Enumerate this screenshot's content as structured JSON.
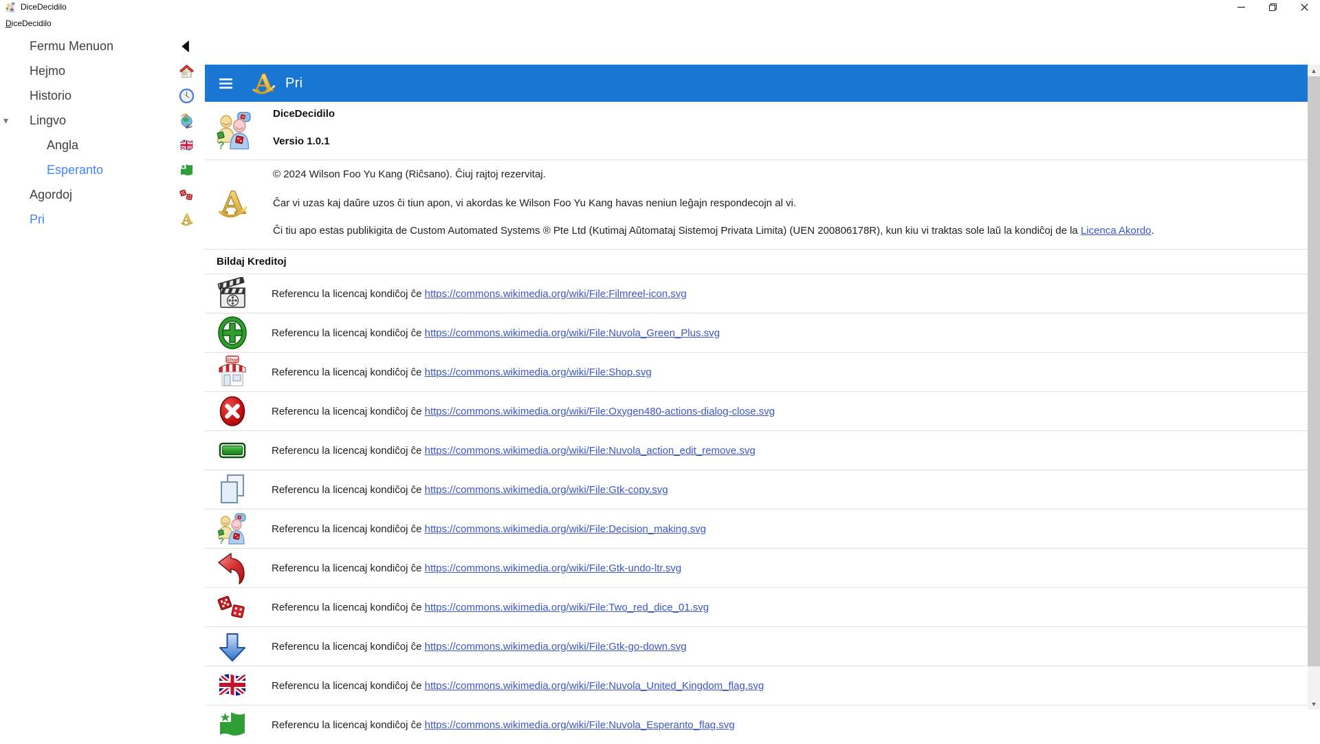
{
  "window": {
    "title": "DiceDecidilo",
    "menu_label": "DiceDecidilo"
  },
  "header": {
    "title": "Pri"
  },
  "sidebar": {
    "items": [
      {
        "label": "Fermu Menuon",
        "icon": "collapse-arrow-icon"
      },
      {
        "label": "Hejmo",
        "icon": "home-icon"
      },
      {
        "label": "Historio",
        "icon": "history-clock-icon"
      },
      {
        "label": "Lingvo",
        "icon": "language-globe-icon",
        "expander": true
      },
      {
        "label": "Angla",
        "icon": "uk-flag-icon",
        "indent": true
      },
      {
        "label": "Esperanto",
        "icon": "esperanto-flag-icon",
        "indent": true,
        "selected": true
      },
      {
        "label": "Agordoj",
        "icon": "red-dice-icon"
      },
      {
        "label": "Pri",
        "icon": "gold-a-icon",
        "selected": true
      }
    ]
  },
  "about": {
    "app_name": "DiceDecidilo",
    "version": "Versio 1.0.1",
    "copyright": "© 2024 Wilson Foo Yu Kang (Riĉsano). Ĉiuj rajtoj rezervitaj.",
    "disclaimer": "Ĉar vi uzas kaj daŭre uzos ĉi tiun apon, vi akordas ke Wilson Foo Yu Kang havas neniun leĝajn respondecojn al vi.",
    "publisher_text": "Ĉi tiu apo estas publikigita de Custom Automated Systems ® Pte Ltd (Kutimaj Aŭtomataj Sistemoj Privata Limita) (UEN 200806178R), kun kiu vi traktas sole laŭ la kondiĉoj de la ",
    "license_link": "Licenca Akordo",
    "publisher_suffix": "."
  },
  "credits": {
    "heading": "Bildaj Kreditoj",
    "prefix": "Referencu la licencaj kondiĉoj ĉe ",
    "items": [
      {
        "icon": "film-clapper-icon",
        "url": "https://commons.wikimedia.org/wiki/File:Filmreel-icon.svg"
      },
      {
        "icon": "green-plus-icon",
        "url": "https://commons.wikimedia.org/wiki/File:Nuvola_Green_Plus.svg"
      },
      {
        "icon": "shop-icon",
        "url": "https://commons.wikimedia.org/wiki/File:Shop.svg"
      },
      {
        "icon": "red-close-icon",
        "url": "https://commons.wikimedia.org/wiki/File:Oxygen480-actions-dialog-close.svg"
      },
      {
        "icon": "green-remove-icon",
        "url": "https://commons.wikimedia.org/wiki/File:Nuvola_action_edit_remove.svg"
      },
      {
        "icon": "copy-pages-icon",
        "url": "https://commons.wikimedia.org/wiki/File:Gtk-copy.svg"
      },
      {
        "icon": "decision-making-icon",
        "url": "https://commons.wikimedia.org/wiki/File:Decision_making.svg"
      },
      {
        "icon": "undo-arrow-icon",
        "url": "https://commons.wikimedia.org/wiki/File:Gtk-undo-ltr.svg"
      },
      {
        "icon": "red-dice-icon",
        "url": "https://commons.wikimedia.org/wiki/File:Two_red_dice_01.svg"
      },
      {
        "icon": "down-arrow-icon",
        "url": "https://commons.wikimedia.org/wiki/File:Gtk-go-down.svg"
      },
      {
        "icon": "uk-flag-icon",
        "url": "https://commons.wikimedia.org/wiki/File:Nuvola_United_Kingdom_flag.svg"
      },
      {
        "icon": "esperanto-flag-icon",
        "url": "https://commons.wikimedia.org/wiki/File:Nuvola_Esperanto_flag.svg"
      }
    ]
  },
  "colors": {
    "header_blue": "#1976d2",
    "link_blue": "#3b55cb",
    "sidebar_selected_blue": "#4285f4",
    "divider_gray": "#e0e0e0"
  }
}
